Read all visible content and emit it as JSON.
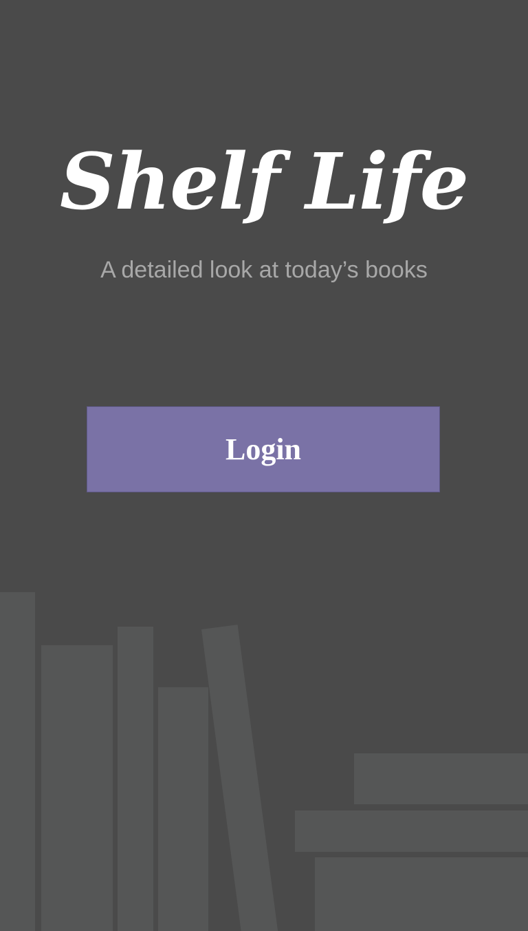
{
  "app": {
    "title": "Shelf Life",
    "tagline": "A detailed look at today’s books"
  },
  "actions": {
    "login_label": "Login"
  },
  "colors": {
    "background": "#4a4a4a",
    "button": "#7a72a6",
    "book": "#555656",
    "tagline": "#a8a8a8"
  }
}
